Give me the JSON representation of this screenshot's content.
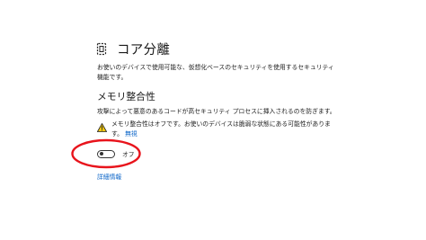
{
  "header": {
    "title": "コア分離",
    "icon": "chip-icon",
    "description": "お使いのデバイスで使用可能な、仮想化ベースのセキュリティを使用するセキュリティ機能です。"
  },
  "memory_integrity": {
    "title": "メモリ整合性",
    "description": "攻撃によって悪意のあるコードが高セキュリティ プロセスに挿入されるのを防ぎます。",
    "warning_icon": "warning-icon",
    "warning_text": "メモリ整合性はオフです。お使いのデバイスは脆弱な状態にある可能性があります。",
    "dismiss_link": "無視",
    "toggle_state_label": "オフ",
    "toggle_on": false
  },
  "more_info_link": "詳細情報",
  "colors": {
    "link": "#0a64c8",
    "warning": "#f2c811",
    "highlight": "#e8141c"
  }
}
